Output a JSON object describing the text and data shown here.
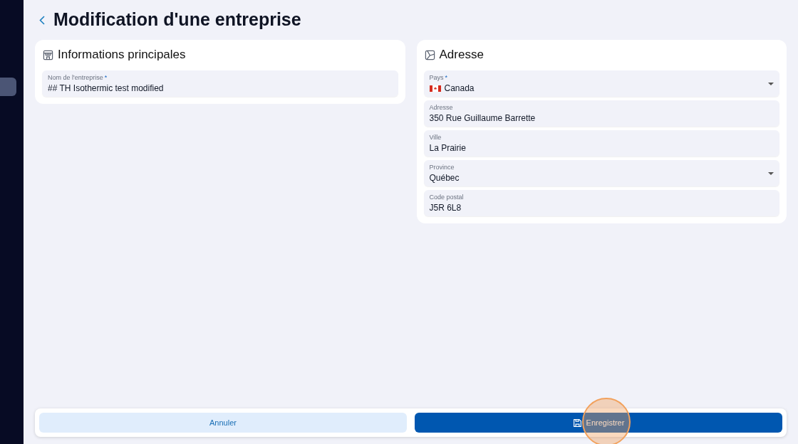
{
  "sidebar": {
    "items": [
      {
        "selected": true
      }
    ]
  },
  "page": {
    "title": "Modification d'une entreprise"
  },
  "sections": [
    {
      "title": "Informations principales",
      "kind": "building",
      "fields": [
        {
          "kind": "text",
          "label": "Nom de l'entreprise",
          "required_mark": "*",
          "value": "## TH Isothermic test modified"
        }
      ]
    },
    {
      "title": "Adresse",
      "kind": "map",
      "fields": [
        {
          "kind": "select",
          "label": "Pays",
          "required_mark": "*",
          "value": "Canada",
          "flag": true
        },
        {
          "kind": "text",
          "label": "Adresse",
          "value": "350 Rue Guillaume Barrette"
        },
        {
          "kind": "text",
          "label": "Ville",
          "value": "La Prairie"
        },
        {
          "kind": "select",
          "label": "Province",
          "value": "Québec"
        },
        {
          "kind": "text",
          "label": "Code postal",
          "value": "J5R 6L8"
        }
      ]
    }
  ],
  "footer": {
    "cancel": "Annuler",
    "save": "Enregistrer",
    "save_clicked": true
  }
}
